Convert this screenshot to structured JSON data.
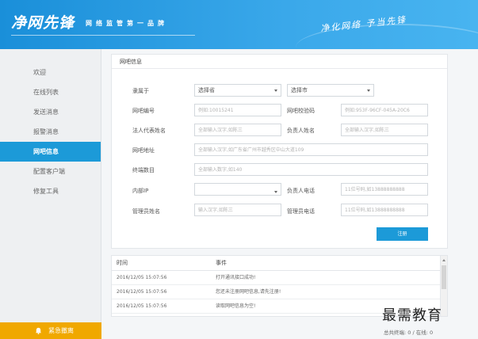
{
  "header": {
    "logo": "净网先锋",
    "slogan": "网络监管第一品牌",
    "motto": "净化网络 予当先锋"
  },
  "sidebar": {
    "items": [
      {
        "label": "欢迎",
        "active": false
      },
      {
        "label": "在线列表",
        "active": false
      },
      {
        "label": "发送消息",
        "active": false
      },
      {
        "label": "报警消息",
        "active": false
      },
      {
        "label": "网吧信息",
        "active": true
      },
      {
        "label": "配置客户端",
        "active": false
      },
      {
        "label": "修复工具",
        "active": false
      }
    ],
    "emergency_label": "紧急撤离"
  },
  "form": {
    "title": "网吧信息",
    "belongs_label": "隶属于",
    "province_value": "选择省",
    "city_value": "选择市",
    "cafe_id_label": "网吧编号",
    "cafe_id_placeholder": "例如:10015241",
    "verify_code_label": "网吧校验码",
    "verify_code_placeholder": "例如:953F-96CF-045A-20C6",
    "legal_rep_label": "法人代表姓名",
    "legal_rep_placeholder": "全部输入汉字,如陈三",
    "manager_label": "负责人姓名",
    "manager_placeholder": "全部输入汉字,如陈三",
    "address_label": "网吧地址",
    "address_placeholder": "全部输入汉字,如广东省广州市越秀区中山大道109",
    "terminals_label": "终端数目",
    "terminals_placeholder": "全部输入数字,如140",
    "internal_ip_label": "内部IP",
    "internal_ip_value": "",
    "manager_phone_label": "负责人电话",
    "manager_phone_placeholder": "11位号码,如13888888888",
    "admin_name_label": "管理员姓名",
    "admin_name_placeholder": "输入汉字,如陈三",
    "admin_phone_label": "管理员电话",
    "admin_phone_placeholder": "11位号码,如13888888888",
    "register_button": "注册"
  },
  "log": {
    "col_time": "时间",
    "col_event": "事件",
    "rows": [
      {
        "time": "2016/12/05 15:07:56",
        "event": "打开通讯接口成功!"
      },
      {
        "time": "2016/12/05 15:07:56",
        "event": "您还未注册网吧信息,请先注册!"
      },
      {
        "time": "2016/12/05 15:07:56",
        "event": "读取网吧信息为空!"
      }
    ]
  },
  "footer": {
    "stats": "总共终端: 0 / 在线: 0"
  },
  "watermark": "最需教育",
  "colors": {
    "accent": "#1c9ad8",
    "emergency": "#f0a800"
  }
}
